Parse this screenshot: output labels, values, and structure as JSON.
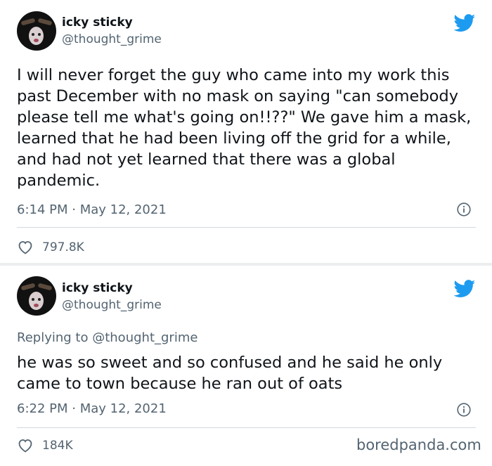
{
  "tweets": [
    {
      "author_name": "icky sticky",
      "author_handle": "@thought_grime",
      "text": "I will never forget the guy who came into my work this past December with no mask on saying \"can somebody please tell me what's going on!!??\" We gave him a mask, learned that he had been living off the grid for a while, and had not yet learned that there was a global pandemic.",
      "timestamp": "6:14 PM · May 12, 2021",
      "likes": "797.8K"
    },
    {
      "author_name": "icky sticky",
      "author_handle": "@thought_grime",
      "replying_label": "Replying to",
      "replying_handle": "@thought_grime",
      "text": "he was so sweet and so confused and he said he only came to town because he ran out of oats",
      "timestamp": "6:22 PM · May 12, 2021",
      "likes": "184K"
    }
  ],
  "watermark": "boredpanda.com",
  "icons": [
    "twitter-bird-icon",
    "info-icon",
    "heart-icon"
  ],
  "colors": {
    "twitter_blue": "#1d9bf0",
    "muted_text": "#536471"
  }
}
